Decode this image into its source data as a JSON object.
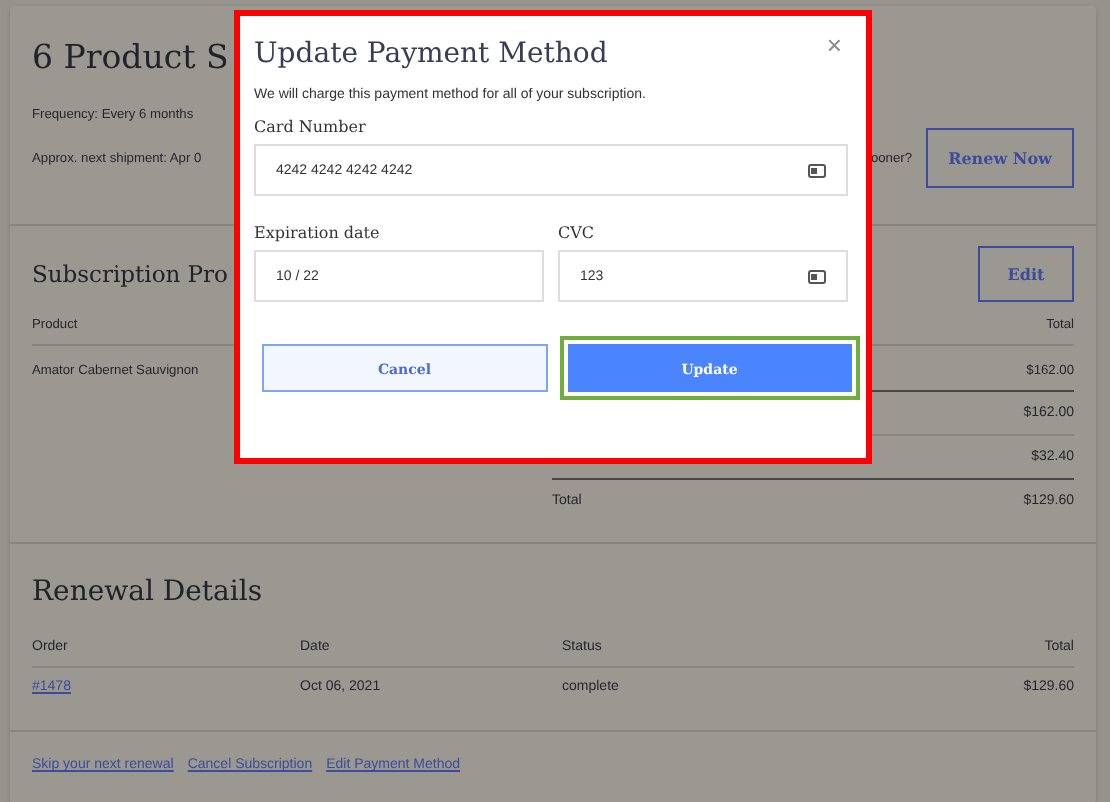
{
  "page": {
    "title": "6 Product S",
    "frequency": "Frequency: Every 6 months",
    "next_shipment": "Approx. next shipment: Apr 0",
    "renew_prompt": "ooner?",
    "renew_button": "Renew Now"
  },
  "subscription": {
    "title": "Subscription Pro",
    "edit_button": "Edit",
    "columns": [
      "Product",
      "Total"
    ],
    "rows": [
      {
        "product": "Amator Cabernet Sauvignon",
        "total": "$162.00"
      }
    ],
    "summary": [
      {
        "value": "$162.00"
      },
      {
        "value": "$32.40"
      },
      {
        "label": "Total",
        "value": "$129.60"
      }
    ]
  },
  "renewal": {
    "title": "Renewal Details",
    "columns": [
      "Order",
      "Date",
      "Status",
      "Total"
    ],
    "rows": [
      {
        "order": "#1478",
        "date": "Oct 06, 2021",
        "status": "complete",
        "total": "$129.60"
      }
    ]
  },
  "links": [
    "Skip your next renewal",
    "Cancel Subscription",
    "Edit Payment Method"
  ],
  "modal": {
    "title": "Update Payment Method",
    "close": "×",
    "highlighted": true,
    "description": "We will charge this payment method for all of your subscription.",
    "field_rows": [
      [
        {
          "label": "Card Number",
          "value": "4242 4242 4242 4242",
          "has_icon": true
        }
      ],
      [
        {
          "label": "Expiration date",
          "value": "10 / 22",
          "has_icon": false
        },
        {
          "label": "CVC",
          "value": "123",
          "has_icon": true
        }
      ]
    ],
    "buttons": [
      {
        "label": "Cancel",
        "kind": "secondary",
        "highlighted": false
      },
      {
        "label": "Update",
        "kind": "primary",
        "highlighted": true
      }
    ]
  }
}
